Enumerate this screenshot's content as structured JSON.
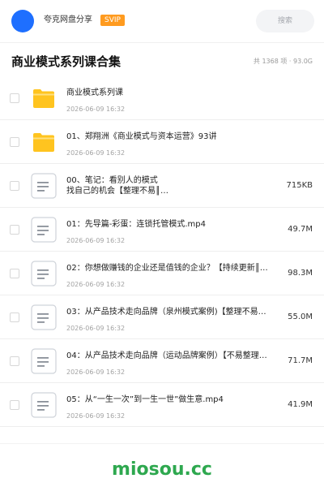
{
  "header": {
    "app_name": "夸克网盘分享",
    "badge": "SVIP",
    "search_placeholder": "搜索"
  },
  "title": "商业模式系列课合集",
  "summary": "共 1368 项 · 93.0G",
  "files": [
    {
      "type": "folder",
      "name": "商业模式系列课",
      "date": "2026-06-09 16:32",
      "size": ""
    },
    {
      "type": "folder",
      "name": "01、郑翔洲《商业模式与资本运营》93讲",
      "date": "2026-06-09 16:32",
      "size": ""
    },
    {
      "type": "doc",
      "name": "00、笔记：看别人的模式",
      "name2": "找自己的机会【整理不易║…",
      "date": "2026-06-09 16:32",
      "size": "715KB"
    },
    {
      "type": "doc",
      "name": "01：先导篇-彩蛋：连锁托管模式.mp4",
      "date": "2026-06-09 16:32",
      "size": "49.7M"
    },
    {
      "type": "doc",
      "name": "02：你想做赚钱的企业还是值钱的企业？【持续更新║…",
      "date": "2026-06-09 16:32",
      "size": "98.3M"
    },
    {
      "type": "doc",
      "name": "03：从产品技术走向品牌（泉州模式案例)【整理不易…",
      "date": "2026-06-09 16:32",
      "size": "55.0M"
    },
    {
      "type": "doc",
      "name": "04：从产品技术走向品牌（运动品牌案例）【不易整理…",
      "date": "2026-06-09 16:32",
      "size": "71.7M"
    },
    {
      "type": "doc",
      "name": "05：从“一生一次”到一生一世”做生意.mp4",
      "date": "2026-06-09 16:32",
      "size": "41.9M"
    }
  ],
  "watermark": "miosou.cc",
  "colors": {
    "avatar": "#1e6fff",
    "badge": "#ff9b1f",
    "folder": "#ffc41f",
    "watermark": "#2ea84f"
  }
}
